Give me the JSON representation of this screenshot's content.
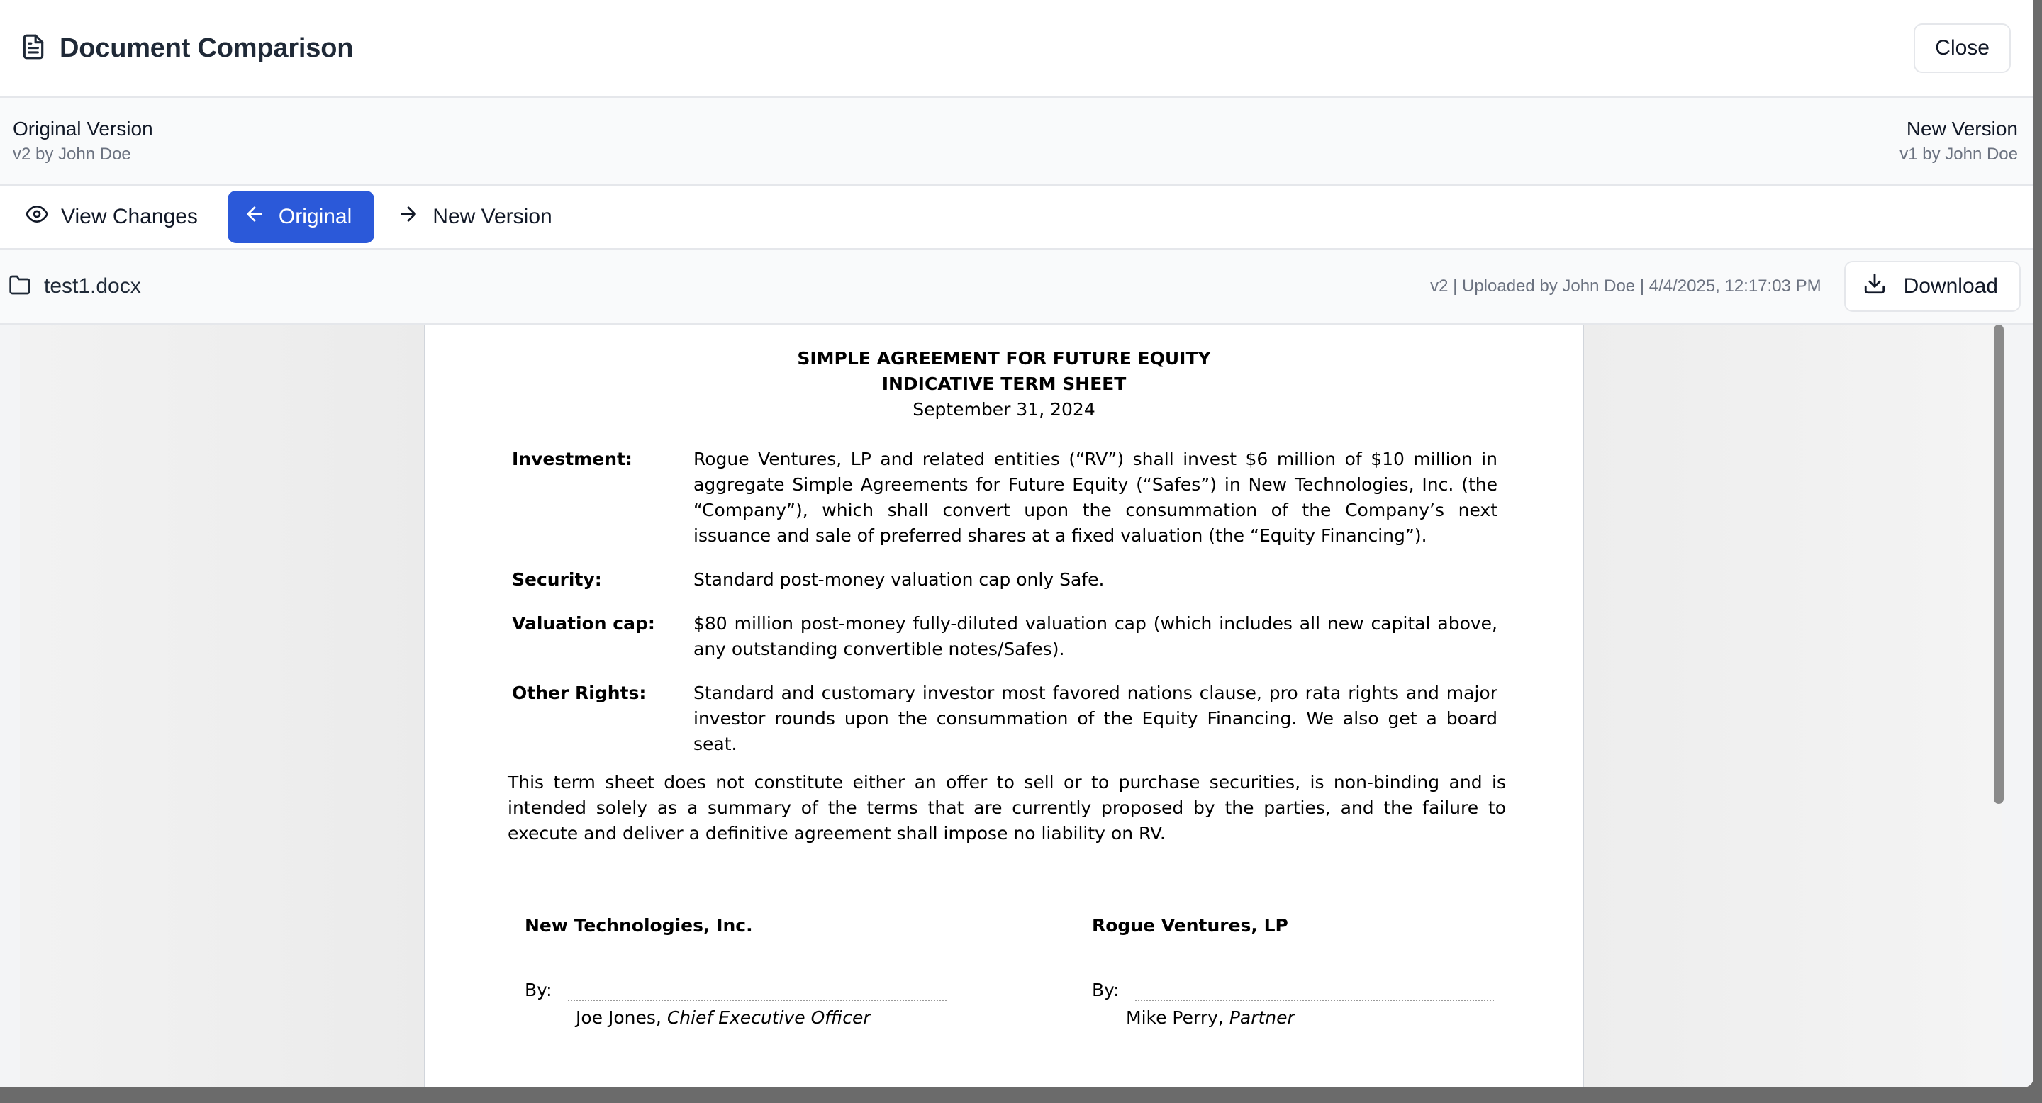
{
  "header": {
    "title": "Document Comparison",
    "close_label": "Close"
  },
  "versions": {
    "original": {
      "title": "Original Version",
      "sub": "v2 by John Doe"
    },
    "new": {
      "title": "New Version",
      "sub": "v1 by John Doe"
    }
  },
  "tabs": [
    {
      "label": "View Changes",
      "icon": "eye-icon"
    },
    {
      "label": "Original",
      "icon": "arrow-left-icon",
      "active": true
    },
    {
      "label": "New Version",
      "icon": "arrow-right-icon"
    }
  ],
  "file": {
    "name": "test1.docx",
    "meta": "v2 | Uploaded by John Doe | 4/4/2025, 12:17:03 PM",
    "download_label": "Download"
  },
  "colors": {
    "accent": "#2b59d9",
    "border": "#e5e7eb",
    "muted_text": "#6b7280"
  },
  "document": {
    "heading1": "SIMPLE AGREEMENT FOR FUTURE EQUITY",
    "heading2": "INDICATIVE TERM SHEET",
    "date": "September 31, 2024",
    "terms": [
      {
        "label": "Investment:",
        "text": "Rogue Ventures, LP and related entities (“RV”) shall invest $6 million of $10 million in aggregate Simple Agreements for Future Equity (“Safes”) in New Technologies, Inc. (the “Company”), which shall convert upon the consummation of the Company’s next issuance and sale of preferred shares at a fixed valuation (the “Equity Financing”)."
      },
      {
        "label": "Security:",
        "text": "Standard post-money valuation cap only Safe."
      },
      {
        "label": "Valuation cap:",
        "text": "$80 million post-money fully-diluted valuation cap (which includes all new capital above, any outstanding convertible notes/Safes)."
      },
      {
        "label": "Other Rights:",
        "text": "Standard and customary investor most favored nations clause, pro rata rights and major investor rounds upon the consummation of the Equity Financing. We also get a board seat."
      }
    ],
    "disclaimer": "This term sheet does not constitute either an offer to sell or to purchase securities, is non-binding and is intended solely as a summary of the terms that are currently proposed by the parties, and the failure to execute and deliver a definitive agreement shall impose no liability on RV.",
    "signatures": [
      {
        "company": "New Technologies, Inc.",
        "by": "By:",
        "name": "Joe Jones, ",
        "role": "Chief Executive Officer"
      },
      {
        "company": "Rogue Ventures, LP",
        "by": "By:",
        "name": "Mike Perry, ",
        "role": "Partner"
      }
    ]
  }
}
